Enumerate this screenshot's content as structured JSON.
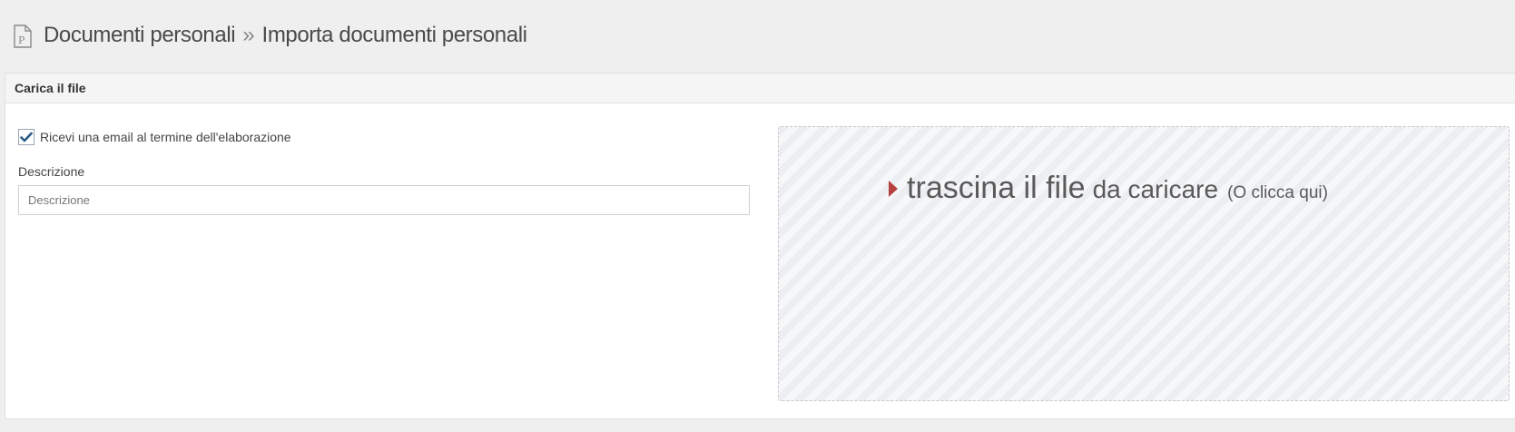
{
  "header": {
    "icon": "document-p-icon",
    "breadcrumb_parent": "Documenti personali",
    "breadcrumb_separator": "»",
    "breadcrumb_current": "Importa documenti personali"
  },
  "panel": {
    "title": "Carica il file"
  },
  "form": {
    "email_checkbox_label": "Ricevi una email al termine dell'elaborazione",
    "email_checkbox_checked": true,
    "description_label": "Descrizione",
    "description_placeholder": "Descrizione",
    "description_value": ""
  },
  "dropzone": {
    "main_text": "trascina il file",
    "sub_text": "da caricare",
    "hint_text": "(O clicca qui)",
    "arrow_color": "#b5413f"
  },
  "colors": {
    "checkbox_check": "#2b5a8a",
    "background": "#efefef"
  }
}
